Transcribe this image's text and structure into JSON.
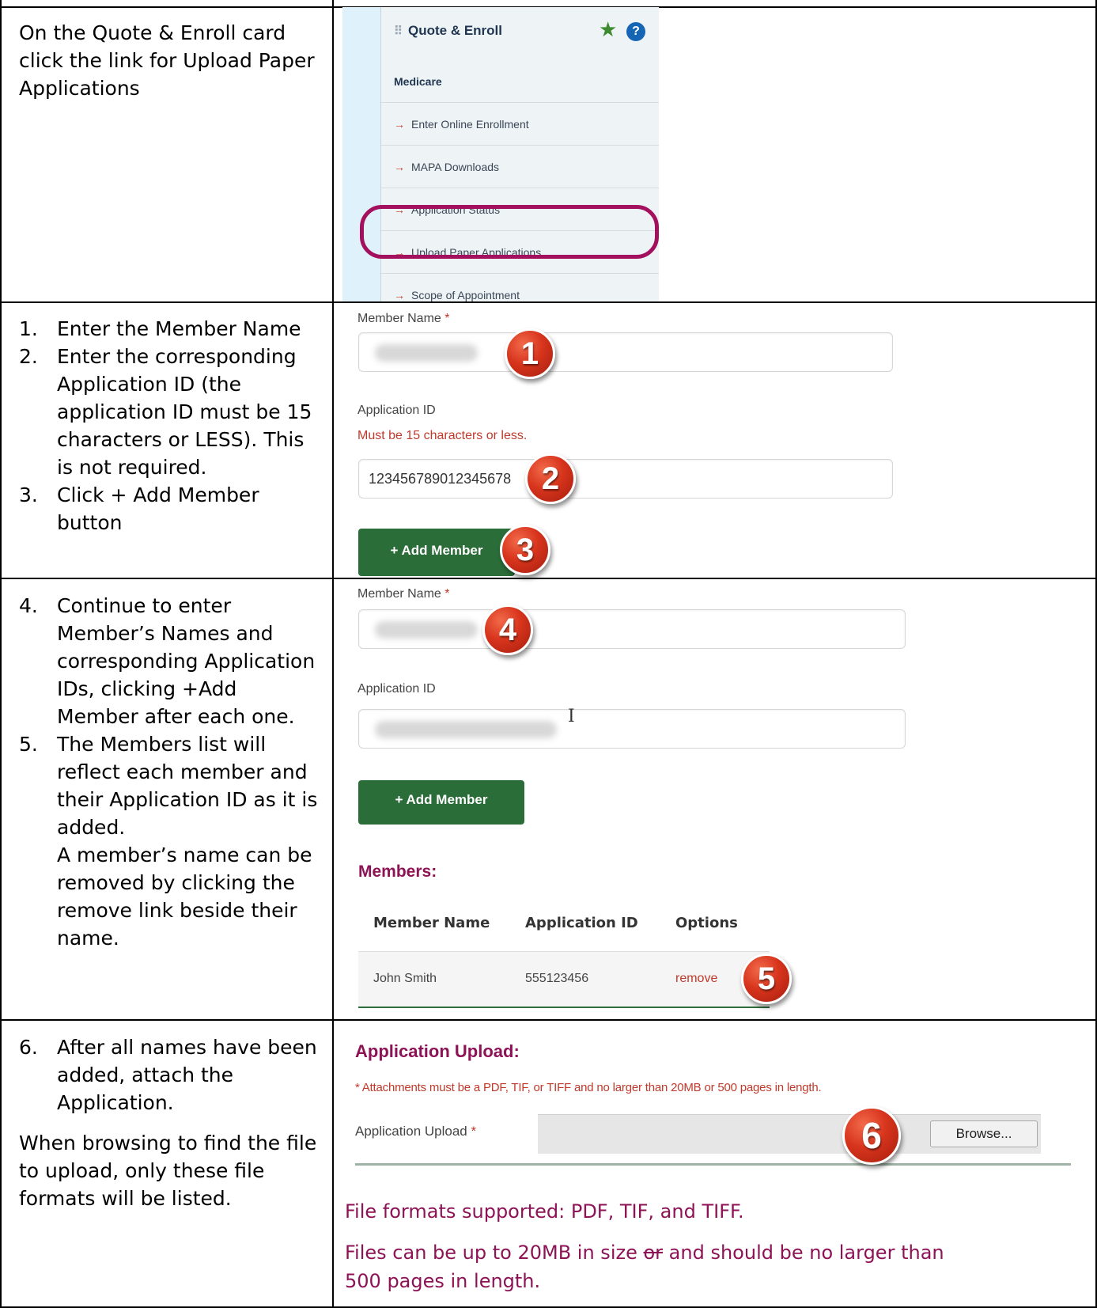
{
  "row1": {
    "instruction": "On the Quote & Enroll card click the link for Upload Paper Applications",
    "card": {
      "title": "Quote & Enroll",
      "section": "Medicare",
      "links": [
        "Enter Online Enrollment",
        "MAPA Downloads",
        "Application Status",
        "Upload Paper Applications",
        "Scope of Appointment"
      ],
      "accent_color": "#a3105d"
    }
  },
  "row2": {
    "steps": [
      {
        "num": "1.",
        "text": "Enter the Member Name"
      },
      {
        "num": "2.",
        "text": "Enter the corresponding Application ID (the application ID must be 15 characters or LESS). This is not required."
      },
      {
        "num": "3.",
        "text": "Click + Add Member button"
      }
    ],
    "form": {
      "member_name_label": "Member Name",
      "required_mark": "*",
      "application_id_label": "Application ID",
      "application_id_hint": "Must be 15 characters or less.",
      "application_id_value": "123456789012345678",
      "add_button": "+ Add Member"
    },
    "badges": [
      "1",
      "2",
      "3"
    ]
  },
  "row3": {
    "steps": [
      {
        "num": "4.",
        "text": "Continue to enter Member’s Names and corresponding Application IDs, clicking +Add Member after each one."
      },
      {
        "num": "5.",
        "text": "The Members list will reflect each member and their Application ID as it is added."
      }
    ],
    "step5_extra": "A member’s name can be removed by clicking the remove link beside their name.",
    "form": {
      "member_name_label": "Member Name",
      "required_mark": "*",
      "application_id_label": "Application ID",
      "add_button": "+ Add Member"
    },
    "members": {
      "title": "Members:",
      "columns": [
        "Member Name",
        "Application ID",
        "Options"
      ],
      "rows": [
        {
          "name": "John Smith",
          "application_id": "555123456",
          "option": "remove"
        }
      ]
    },
    "badges": [
      "4",
      "5"
    ]
  },
  "row4": {
    "steps": [
      {
        "num": "6.",
        "text": "After all names have been added, attach the Application."
      }
    ],
    "paragraph": "When browsing to find the file to upload, only these file formats will be listed.",
    "upload": {
      "title": "Application Upload:",
      "note": "* Attachments must be a PDF, TIF, or TIFF and no larger than 20MB or 500 pages in length.",
      "label": "Application Upload",
      "required_mark": "*",
      "browse_button": "Browse..."
    },
    "badge": "6",
    "formats_note": "File formats supported: PDF, TIF, and TIFF.",
    "size_note_a": "Files can be up to 20MB in size ",
    "size_note_strike": "or",
    "size_note_b": " and should be no larger than",
    "size_note_c": "500 pages in length."
  }
}
